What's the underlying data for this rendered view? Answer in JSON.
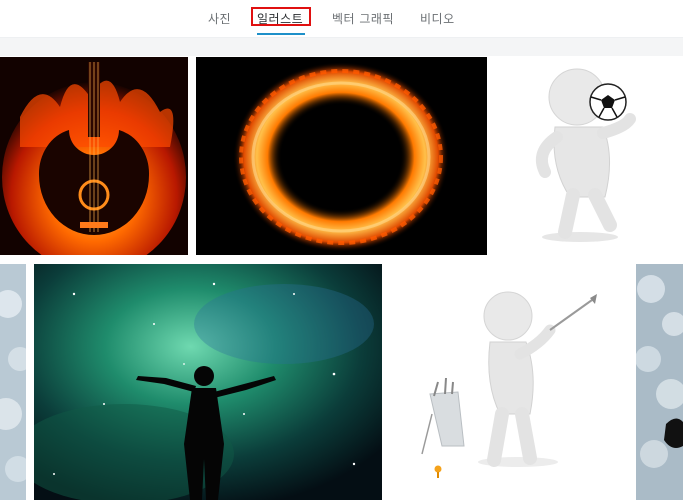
{
  "tabs": [
    {
      "label": "사진",
      "active": false
    },
    {
      "label": "일러스트",
      "active": true
    },
    {
      "label": "벡터 그래픽",
      "active": false
    },
    {
      "label": "비디오",
      "active": false
    }
  ],
  "colors": {
    "accent_underline": "#1e90c9",
    "highlight_box": "#e01010",
    "fire": "#ff6a00",
    "space_green": "#1f8c6c"
  },
  "gallery": [
    {
      "subject": "fire guitar",
      "icon": "fire-guitar-image"
    },
    {
      "subject": "fire ring",
      "icon": "fire-ring-image"
    },
    {
      "subject": "3d figure with soccer ball",
      "icon": "soccer-figure-image"
    },
    {
      "subject": "bokeh (partial)",
      "icon": "bokeh-image"
    },
    {
      "subject": "silhouette in starry nebula",
      "icon": "nebula-silhouette-image"
    },
    {
      "subject": "3d figure playing golf",
      "icon": "golf-figure-image"
    },
    {
      "subject": "bokeh with silhouette (partial)",
      "icon": "bokeh-silhouette-image"
    }
  ]
}
